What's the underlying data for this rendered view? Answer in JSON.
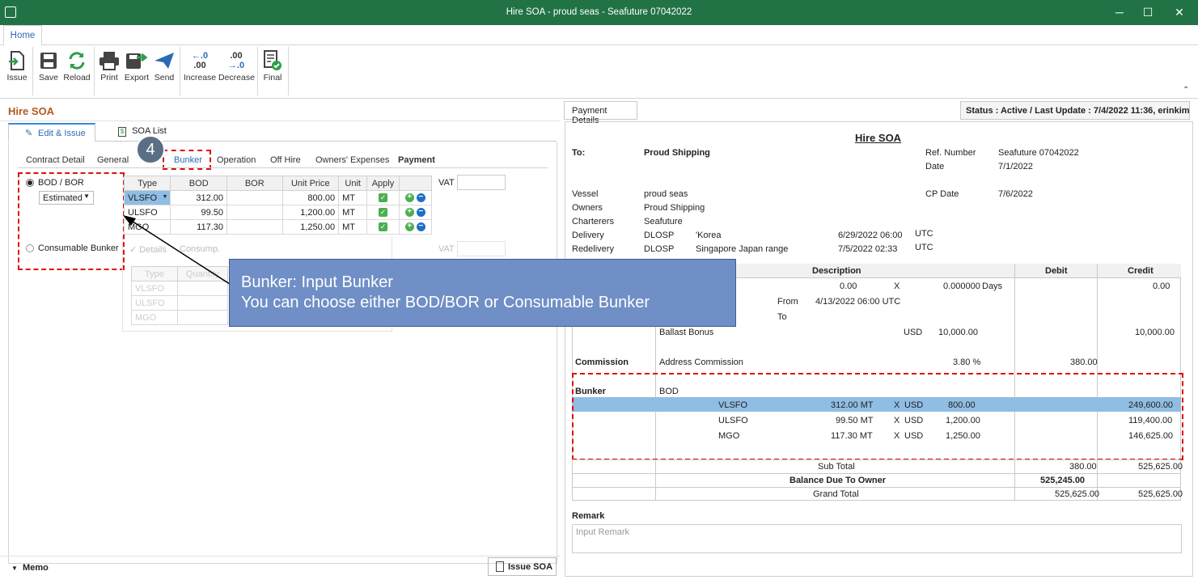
{
  "window": {
    "title": "Hire SOA - proud seas - Seafuture 07042022",
    "minimize": "─",
    "maximize": "☐",
    "close": "✕"
  },
  "ribbon": {
    "tab": "Home",
    "buttons": {
      "issue": "Issue",
      "save": "Save",
      "reload": "Reload",
      "print": "Print",
      "export": "Export",
      "send": "Send",
      "increase": "Increase",
      "decrease": "Decrease",
      "final": "Final"
    },
    "increase_glyph_top": "←.0",
    "increase_glyph_bottom": ".00",
    "decrease_glyph_top": ".00",
    "decrease_glyph_bottom": "→.0"
  },
  "left": {
    "title": "Hire SOA",
    "tabs": {
      "edit": "Edit & Issue",
      "list": "SOA List"
    },
    "subtabs": {
      "contract": "Contract Detail",
      "general": "General",
      "bunker": "Bunker",
      "operation": "Operation",
      "offhire": "Off Hire",
      "owners": "Owners' Expenses",
      "payment": "Payment"
    },
    "step": "4",
    "bod_bor": "BOD / BOR",
    "estimated": "Estimated",
    "consumable": "Consumable Bunker",
    "vat": "VAT",
    "vat2": "VAT",
    "grid_headers": [
      "Type",
      "BOD",
      "BOR",
      "Unit Price",
      "Unit",
      "Apply"
    ],
    "grid_rows": [
      {
        "type": "VLSFO",
        "bod": "312.00",
        "bor": "",
        "price": "800.00",
        "unit": "MT"
      },
      {
        "type": "ULSFO",
        "bod": "99.50",
        "bor": "",
        "price": "1,200.00",
        "unit": "MT"
      },
      {
        "type": "MGO",
        "bod": "117.30",
        "bor": "",
        "price": "1,250.00",
        "unit": "MT"
      }
    ],
    "ghost_checkbox": "✓ Details",
    "ghost_cons": "Consump.",
    "ghost_header": "Type",
    "ghost_header2": "Quantity",
    "ghost_rows": [
      "VLSFO",
      "ULSFO",
      "MGO"
    ],
    "memo": "Memo",
    "issue_soa": "Issue SOA"
  },
  "callout": {
    "line1": "Bunker: Input Bunker",
    "line2": "You can choose either BOD/BOR or Consumable Bunker"
  },
  "right": {
    "payment_details": "Payment Details",
    "status": "Status : Active /  Last Update : 7/4/2022 11:36, erinkim",
    "doc_title": "Hire SOA",
    "to_label": "To:",
    "to_value": "Proud Shipping",
    "ref_label": "Ref. Number",
    "ref_value": "Seafuture 07042022",
    "date_label": "Date",
    "date_value": "7/1/2022",
    "vessel_label": "Vessel",
    "vessel_value": "proud seas",
    "cpdate_label": "CP Date",
    "cpdate_value": "7/6/2022",
    "owners_label": "Owners",
    "owners_value": "Proud Shipping",
    "charterers_label": "Charterers",
    "charterers_value": "Seafuture",
    "delivery_label": "Delivery",
    "delivery_port": "DLOSP",
    "delivery_place": "'Korea",
    "delivery_time": "6/29/2022 06:00",
    "delivery_tz": "UTC",
    "redelivery_label": "Redelivery",
    "redelivery_port": "DLOSP",
    "redelivery_place": "Singapore Japan range",
    "redelivery_time": "7/5/2022 02:33",
    "redelivery_tz": "UTC",
    "hdr_description": "Description",
    "hdr_debit": "Debit",
    "hdr_credit": "Credit",
    "hire_qty": "0.00",
    "hire_x": "X",
    "hire_rate": "0.000000",
    "hire_unit": "Days",
    "hire_credit": "0.00",
    "from_label": "From",
    "from_value": "4/13/2022 06:00 UTC",
    "to2_label": "To",
    "ballast": "Ballast Bonus",
    "ballast_cur": "USD",
    "ballast_amt": "10,000.00",
    "ballast_credit": "10,000.00",
    "commission": "Commission",
    "address_comm": "Address Commission",
    "comm_pct": "3.80 %",
    "comm_debit": "380.00",
    "bunker": "Bunker",
    "bod": "BOD",
    "bunker_rows": [
      {
        "type": "VLSFO",
        "qty": "312.00 MT",
        "x": "X",
        "cur": "USD",
        "price": "800.00",
        "credit": "249,600.00"
      },
      {
        "type": "ULSFO",
        "qty": "99.50 MT",
        "x": "X",
        "cur": "USD",
        "price": "1,200.00",
        "credit": "119,400.00"
      },
      {
        "type": "MGO",
        "qty": "117.30 MT",
        "x": "X",
        "cur": "USD",
        "price": "1,250.00",
        "credit": "146,625.00"
      }
    ],
    "subtotal_label": "Sub Total",
    "subtotal_debit": "380.00",
    "subtotal_credit": "525,625.00",
    "balance_label": "Balance Due To Owner",
    "balance_value": "525,245.00",
    "grand_label": "Grand Total",
    "grand_debit": "525,625.00",
    "grand_credit": "525,625.00",
    "remark_label": "Remark",
    "remark_placeholder": "Input Remark"
  },
  "colors": {
    "titlebar": "#217346",
    "accent": "#2b6bb5",
    "highlight": "#8fbde3",
    "callout": "#6f8fc6",
    "dash": "#dd1111"
  }
}
